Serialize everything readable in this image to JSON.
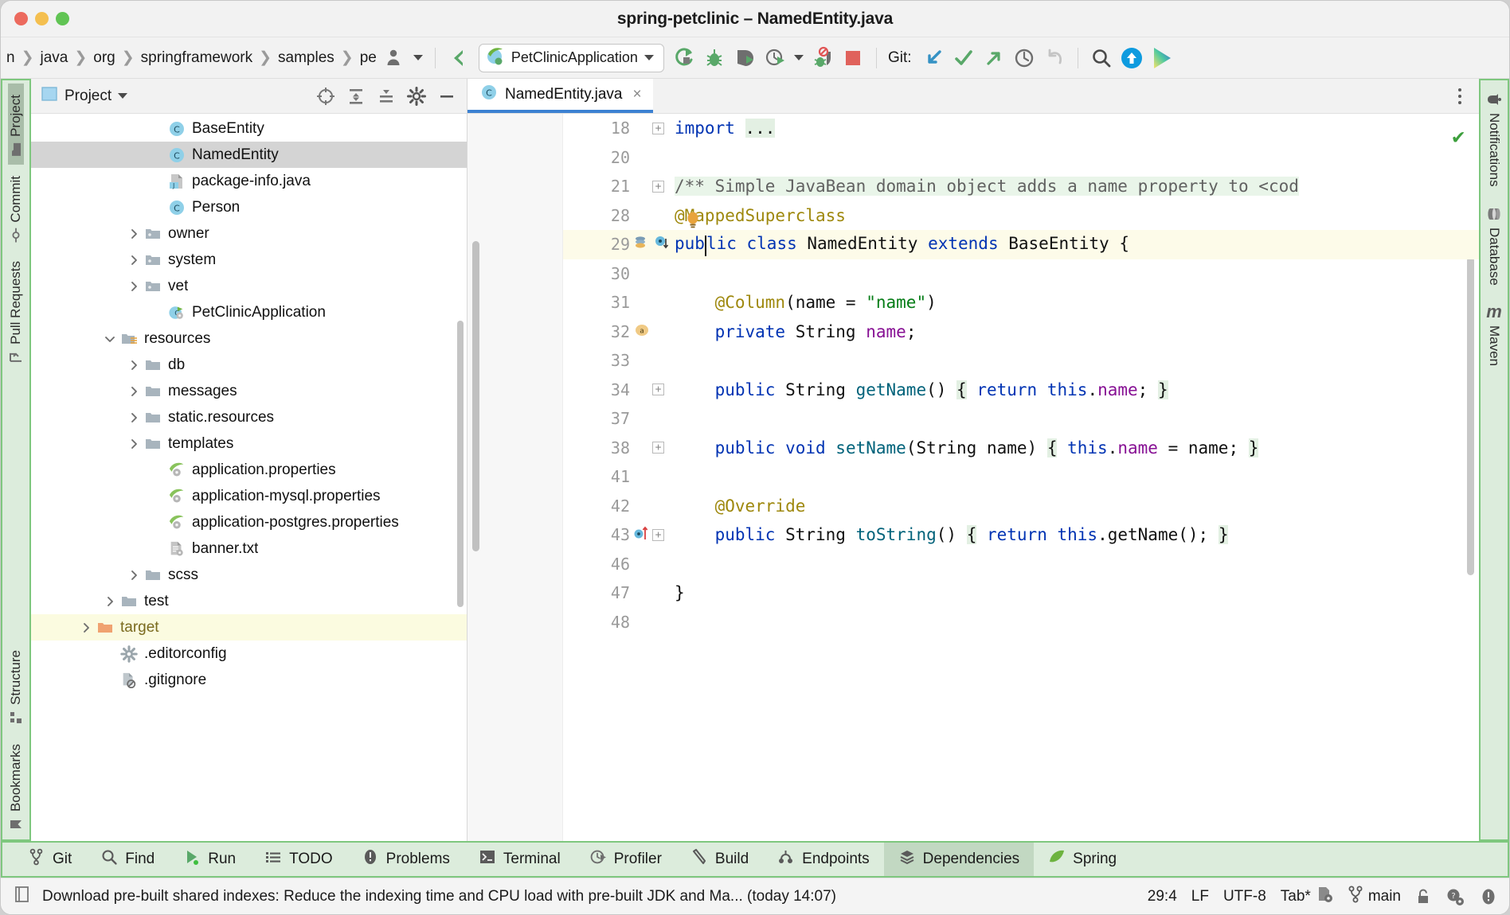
{
  "window": {
    "title": "spring-petclinic – NamedEntity.java",
    "traffic_lights": [
      "close",
      "minimize",
      "maximize"
    ]
  },
  "toolbar": {
    "breadcrumbs": [
      "n",
      "java",
      "org",
      "springframework",
      "samples",
      "pe"
    ],
    "run_config": {
      "label": "PetClinicApplication",
      "icon": "spring-boot-icon"
    },
    "git_label": "Git:",
    "actions": [
      {
        "name": "profile-icon",
        "title": "Profiler"
      },
      {
        "name": "back-arrow-icon",
        "title": "Back"
      },
      {
        "name": "run-icon",
        "title": "Run"
      },
      {
        "name": "debug-icon",
        "title": "Debug"
      },
      {
        "name": "run-with-coverage-icon",
        "title": "Run with Coverage"
      },
      {
        "name": "profile-run-icon",
        "title": "Profile"
      },
      {
        "name": "stop-debug-icon",
        "title": "Stop debugger"
      },
      {
        "name": "stop-icon",
        "title": "Stop"
      },
      {
        "name": "git-update-icon",
        "title": "Update Project"
      },
      {
        "name": "git-commit-icon",
        "title": "Commit"
      },
      {
        "name": "git-push-icon",
        "title": "Push"
      },
      {
        "name": "git-history-icon",
        "title": "History"
      },
      {
        "name": "git-rollback-icon",
        "title": "Rollback"
      },
      {
        "name": "search-everywhere-icon",
        "title": "Search Everywhere"
      },
      {
        "name": "updates-icon",
        "title": "Updates"
      },
      {
        "name": "ai-assistant-icon",
        "title": "AI Assistant"
      }
    ]
  },
  "left_stripe": {
    "items": [
      {
        "label": "Project",
        "icon": "folder-icon",
        "selected": true
      },
      {
        "label": "Commit",
        "icon": "commit-icon",
        "selected": false
      },
      {
        "label": "Pull Requests",
        "icon": "pull-request-icon",
        "selected": false
      },
      {
        "label": "Structure",
        "icon": "structure-icon",
        "selected": false
      },
      {
        "label": "Bookmarks",
        "icon": "bookmark-icon",
        "selected": false
      }
    ]
  },
  "right_stripe": {
    "items": [
      {
        "label": "Notifications",
        "icon": "bell-icon"
      },
      {
        "label": "Database",
        "icon": "database-icon"
      },
      {
        "label": "Maven",
        "icon": "maven-icon"
      }
    ]
  },
  "project_panel": {
    "title": "Project",
    "header_icons": [
      {
        "name": "select-opened-file-icon"
      },
      {
        "name": "expand-all-icon"
      },
      {
        "name": "collapse-all-icon"
      },
      {
        "name": "settings-gear-icon"
      },
      {
        "name": "hide-panel-icon"
      }
    ],
    "tree": [
      {
        "label": "BaseEntity",
        "icon": "java-class-icon",
        "indent": 5,
        "arrow": "none",
        "state": "normal"
      },
      {
        "label": "NamedEntity",
        "icon": "java-class-icon",
        "indent": 5,
        "arrow": "none",
        "state": "selected"
      },
      {
        "label": "package-info.java",
        "icon": "java-file-icon",
        "indent": 5,
        "arrow": "none",
        "state": "normal"
      },
      {
        "label": "Person",
        "icon": "java-class-icon",
        "indent": 5,
        "arrow": "none",
        "state": "normal"
      },
      {
        "label": "owner",
        "icon": "package-folder-icon",
        "indent": 4,
        "arrow": "collapsed",
        "state": "normal"
      },
      {
        "label": "system",
        "icon": "package-folder-icon",
        "indent": 4,
        "arrow": "collapsed",
        "state": "normal"
      },
      {
        "label": "vet",
        "icon": "package-folder-icon",
        "indent": 4,
        "arrow": "collapsed",
        "state": "normal"
      },
      {
        "label": "PetClinicApplication",
        "icon": "spring-class-icon",
        "indent": 5,
        "arrow": "none",
        "state": "normal"
      },
      {
        "label": "resources",
        "icon": "resources-folder-icon",
        "indent": 3,
        "arrow": "expanded",
        "state": "normal"
      },
      {
        "label": "db",
        "icon": "folder-icon",
        "indent": 4,
        "arrow": "collapsed",
        "state": "normal"
      },
      {
        "label": "messages",
        "icon": "folder-icon",
        "indent": 4,
        "arrow": "collapsed",
        "state": "normal"
      },
      {
        "label": "static.resources",
        "icon": "folder-icon",
        "indent": 4,
        "arrow": "collapsed",
        "state": "normal"
      },
      {
        "label": "templates",
        "icon": "folder-icon",
        "indent": 4,
        "arrow": "collapsed",
        "state": "normal"
      },
      {
        "label": "application.properties",
        "icon": "spring-properties-icon",
        "indent": 5,
        "arrow": "none",
        "state": "normal"
      },
      {
        "label": "application-mysql.properties",
        "icon": "spring-properties-icon",
        "indent": 5,
        "arrow": "none",
        "state": "normal"
      },
      {
        "label": "application-postgres.properties",
        "icon": "spring-properties-icon",
        "indent": 5,
        "arrow": "none",
        "state": "normal"
      },
      {
        "label": "banner.txt",
        "icon": "text-file-icon",
        "indent": 5,
        "arrow": "none",
        "state": "normal"
      },
      {
        "label": "scss",
        "icon": "folder-icon",
        "indent": 4,
        "arrow": "collapsed",
        "state": "normal"
      },
      {
        "label": "test",
        "icon": "folder-icon",
        "indent": 3,
        "arrow": "collapsed",
        "state": "normal"
      },
      {
        "label": "target",
        "icon": "excluded-folder-icon",
        "indent": 2,
        "arrow": "collapsed",
        "state": "highlighted"
      },
      {
        "label": ".editorconfig",
        "icon": "editorconfig-icon",
        "indent": 3,
        "arrow": "none",
        "state": "normal"
      },
      {
        "label": ".gitignore",
        "icon": "gitignore-icon",
        "indent": 3,
        "arrow": "none",
        "state": "normal"
      }
    ]
  },
  "editor": {
    "tab": {
      "label": "NamedEntity.java",
      "icon": "java-class-icon",
      "close": "×"
    },
    "inspection_status": "✔",
    "lines": [
      {
        "num": "18",
        "fold": "+",
        "segments": [
          {
            "t": "import ",
            "c": "impblue"
          },
          {
            "t": "...",
            "c": "brhl"
          }
        ]
      },
      {
        "num": "20",
        "fold": "",
        "segments": []
      },
      {
        "num": "21",
        "fold": "+",
        "segments": [
          {
            "t": "/** Simple JavaBean domain object adds a name property to <cod",
            "c": "cmt"
          }
        ]
      },
      {
        "num": "28",
        "fold": "",
        "segments": [
          {
            "t": "@MappedSuperclass",
            "c": "ann"
          }
        ],
        "bulb": true
      },
      {
        "num": "29",
        "fold": "",
        "current": true,
        "gutter_marks": [
          "overridden-icon",
          "implemented-icon"
        ],
        "segments": [
          {
            "t": "pub",
            "c": "kw"
          },
          {
            "t": "CARET",
            "c": "caret"
          },
          {
            "t": "lic class ",
            "c": "kw"
          },
          {
            "t": "NamedEntity ",
            "c": "plain"
          },
          {
            "t": "extends ",
            "c": "kw"
          },
          {
            "t": "BaseEntity {",
            "c": "plain"
          }
        ]
      },
      {
        "num": "30",
        "fold": "",
        "segments": []
      },
      {
        "num": "31",
        "fold": "",
        "segments": [
          {
            "t": "    @Column",
            "c": "ann"
          },
          {
            "t": "(name = ",
            "c": "plain"
          },
          {
            "t": "\"name\"",
            "c": "str"
          },
          {
            "t": ")",
            "c": "plain"
          }
        ]
      },
      {
        "num": "32",
        "fold": "",
        "gutter_marks": [
          "annotation-badge"
        ],
        "segments": [
          {
            "t": "    private ",
            "c": "kw"
          },
          {
            "t": "String ",
            "c": "plain"
          },
          {
            "t": "name",
            "c": "fld"
          },
          {
            "t": ";",
            "c": "plain"
          }
        ]
      },
      {
        "num": "33",
        "fold": "",
        "segments": []
      },
      {
        "num": "34",
        "fold": "+",
        "segments": [
          {
            "t": "    public ",
            "c": "kw"
          },
          {
            "t": "String ",
            "c": "plain"
          },
          {
            "t": "getName",
            "c": "mth"
          },
          {
            "t": "() ",
            "c": "plain"
          },
          {
            "t": "{",
            "c": "brhl"
          },
          {
            "t": " return ",
            "c": "kw"
          },
          {
            "t": "this",
            "c": "kw"
          },
          {
            "t": ".",
            "c": "plain"
          },
          {
            "t": "name",
            "c": "fld"
          },
          {
            "t": "; ",
            "c": "plain"
          },
          {
            "t": "}",
            "c": "brhl"
          }
        ]
      },
      {
        "num": "37",
        "fold": "",
        "segments": []
      },
      {
        "num": "38",
        "fold": "+",
        "segments": [
          {
            "t": "    public ",
            "c": "kw"
          },
          {
            "t": "void ",
            "c": "kw"
          },
          {
            "t": "setName",
            "c": "mth"
          },
          {
            "t": "(String name) ",
            "c": "plain"
          },
          {
            "t": "{",
            "c": "brhl"
          },
          {
            "t": " this",
            "c": "kw"
          },
          {
            "t": ".",
            "c": "plain"
          },
          {
            "t": "name",
            "c": "fld"
          },
          {
            "t": " = name; ",
            "c": "plain"
          },
          {
            "t": "}",
            "c": "brhl"
          }
        ]
      },
      {
        "num": "41",
        "fold": "",
        "segments": []
      },
      {
        "num": "42",
        "fold": "",
        "segments": [
          {
            "t": "    @Override",
            "c": "ann"
          }
        ]
      },
      {
        "num": "43",
        "fold": "+",
        "gutter_marks": [
          "overriding-icon"
        ],
        "segments": [
          {
            "t": "    public ",
            "c": "kw"
          },
          {
            "t": "String ",
            "c": "plain"
          },
          {
            "t": "toString",
            "c": "mth"
          },
          {
            "t": "() ",
            "c": "plain"
          },
          {
            "t": "{",
            "c": "brhl"
          },
          {
            "t": " return ",
            "c": "kw"
          },
          {
            "t": "this",
            "c": "kw"
          },
          {
            "t": ".",
            "c": "plain"
          },
          {
            "t": "getName(); ",
            "c": "plain"
          },
          {
            "t": "}",
            "c": "brhl"
          }
        ]
      },
      {
        "num": "46",
        "fold": "",
        "segments": []
      },
      {
        "num": "47",
        "fold": "",
        "segments": [
          {
            "t": "}",
            "c": "plain"
          }
        ]
      },
      {
        "num": "48",
        "fold": "",
        "segments": []
      }
    ]
  },
  "toolwindow_bar": {
    "items": [
      {
        "label": "Git",
        "icon": "git-branch-icon",
        "selected": false
      },
      {
        "label": "Find",
        "icon": "search-icon",
        "selected": false
      },
      {
        "label": "Run",
        "icon": "run-triangle-icon",
        "selected": false
      },
      {
        "label": "TODO",
        "icon": "todo-list-icon",
        "selected": false
      },
      {
        "label": "Problems",
        "icon": "problems-icon",
        "selected": false
      },
      {
        "label": "Terminal",
        "icon": "terminal-icon",
        "selected": false
      },
      {
        "label": "Profiler",
        "icon": "profiler-icon",
        "selected": false
      },
      {
        "label": "Build",
        "icon": "build-hammer-icon",
        "selected": false
      },
      {
        "label": "Endpoints",
        "icon": "endpoints-icon",
        "selected": false
      },
      {
        "label": "Dependencies",
        "icon": "dependencies-icon",
        "selected": true
      },
      {
        "label": "Spring",
        "icon": "spring-leaf-icon",
        "selected": false
      }
    ]
  },
  "statusbar": {
    "message": "Download pre-built shared indexes: Reduce the indexing time and CPU load with pre-built JDK and Ma... (today 14:07)",
    "caret_position": "29:4",
    "line_separator": "LF",
    "encoding": "UTF-8",
    "indent": "Tab*",
    "branch": "main",
    "icons": [
      {
        "name": "memory-indicator-icon"
      },
      {
        "name": "read-only-lock-icon"
      },
      {
        "name": "inspection-profile-icon"
      },
      {
        "name": "notifications-status-icon"
      }
    ]
  },
  "colors": {
    "accent_green": "#7ec77e",
    "stripe_bg": "#dcecdc",
    "tab_underline": "#3c81d2",
    "selection_gray": "#d4d4d4",
    "highlight_yellow": "#fbfbe0",
    "keyword_blue": "#0033b3",
    "annotation_gold": "#9e880d",
    "string_green": "#067d17",
    "field_purple": "#871094",
    "method_teal": "#00627a"
  }
}
